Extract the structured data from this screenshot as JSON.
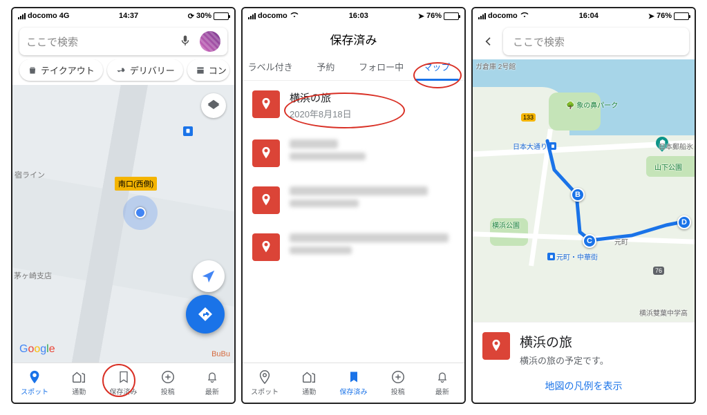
{
  "phone1": {
    "status": {
      "carrier": "docomo",
      "net": "4G",
      "time": "14:37",
      "battery": "30%",
      "battery_fill": 30
    },
    "search_placeholder": "ここで検索",
    "chips": [
      "テイクアウト",
      "デリバリー",
      "コン"
    ],
    "station_label": "南口(西側)",
    "poi_labels": {
      "line": "宿ライン",
      "branch": "茅ヶ崎支店",
      "bubu": "BuBu"
    },
    "google": [
      "G",
      "o",
      "o",
      "g",
      "l",
      "e"
    ],
    "nav": [
      {
        "label": "スポット",
        "icon": "pin",
        "active": true
      },
      {
        "label": "通勤",
        "icon": "commute",
        "active": false
      },
      {
        "label": "保存済み",
        "icon": "bookmark",
        "active": false
      },
      {
        "label": "投稿",
        "icon": "plus",
        "active": false
      },
      {
        "label": "最新",
        "icon": "bell",
        "active": false
      }
    ]
  },
  "phone2": {
    "status": {
      "carrier": "docomo",
      "net": "",
      "time": "16:03",
      "battery": "76%",
      "battery_fill": 76
    },
    "header": "保存済み",
    "tabs": [
      "ラベル付き",
      "予約",
      "フォロー中",
      "マップ"
    ],
    "active_tab": 3,
    "item": {
      "title": "横浜の旅",
      "date": "2020年8月18日"
    },
    "nav": [
      {
        "label": "スポット",
        "icon": "pin",
        "active": false
      },
      {
        "label": "通勤",
        "icon": "commute",
        "active": false
      },
      {
        "label": "保存済み",
        "icon": "bookmark-fill",
        "active": true
      },
      {
        "label": "投稿",
        "icon": "plus",
        "active": false
      },
      {
        "label": "最新",
        "icon": "bell",
        "active": false
      }
    ]
  },
  "phone3": {
    "status": {
      "carrier": "docomo",
      "net": "",
      "time": "16:04",
      "battery": "76%",
      "battery_fill": 76
    },
    "search_placeholder": "ここで検索",
    "map_labels": {
      "warehouse": "ガ倉庫 2号館",
      "park": "象の鼻パーク",
      "nihon_odori": "日本大通り",
      "yusen": "日本郵船氷",
      "yamashita": "山下公園",
      "yokohama": "横浜公園",
      "motomachi": "元町",
      "station": "元町・中華街",
      "school": "横浜雙葉中学高",
      "route133": "133",
      "p76": "76"
    },
    "waypoints": [
      "B",
      "C",
      "D"
    ],
    "card": {
      "title": "横浜の旅",
      "subtitle": "横浜の旅の予定です。",
      "legend": "地図の凡例を表示"
    }
  }
}
